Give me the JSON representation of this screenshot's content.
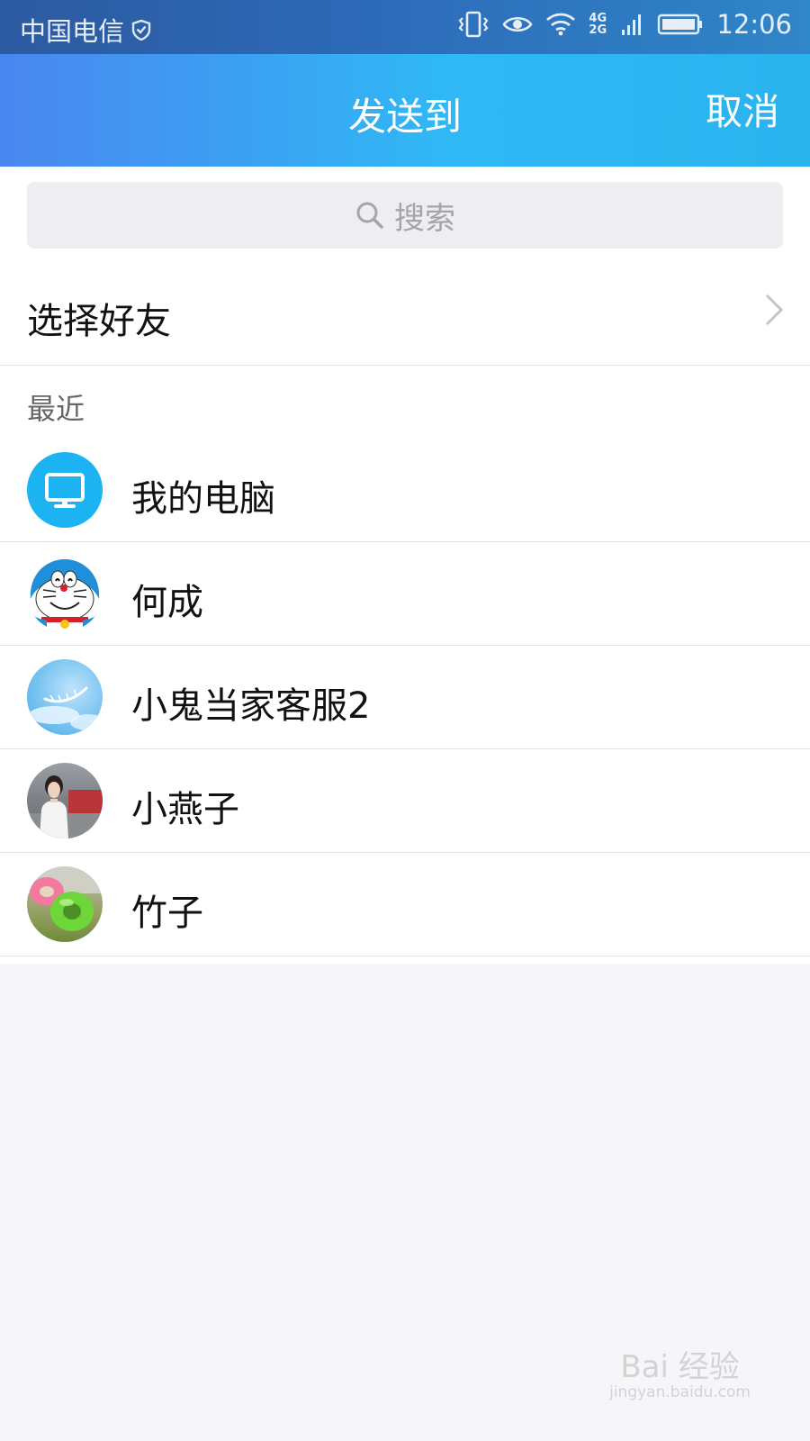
{
  "status_bar": {
    "carrier": "中国电信",
    "network": "4G 2G",
    "time": "12:06"
  },
  "nav": {
    "title": "发送到",
    "cancel_label": "取消"
  },
  "search": {
    "placeholder": "搜索"
  },
  "select_friends": {
    "label": "选择好友"
  },
  "recent": {
    "header": "最近",
    "contacts": [
      {
        "name": "我的电脑",
        "avatar": "computer-avatar"
      },
      {
        "name": "何成",
        "avatar": "doraemon-avatar"
      },
      {
        "name": "小鬼当家客服2",
        "avatar": "sky-feather-avatar"
      },
      {
        "name": "小燕子",
        "avatar": "person-photo-avatar"
      },
      {
        "name": "竹子",
        "avatar": "swim-rings-avatar"
      }
    ]
  },
  "watermark": {
    "brand": "Bai 经验",
    "url": "jingyan.baidu.com"
  },
  "colors": {
    "nav_start": "#4a86f0",
    "nav_end": "#2ab4ee",
    "computer_avatar": "#1cb3f2"
  }
}
